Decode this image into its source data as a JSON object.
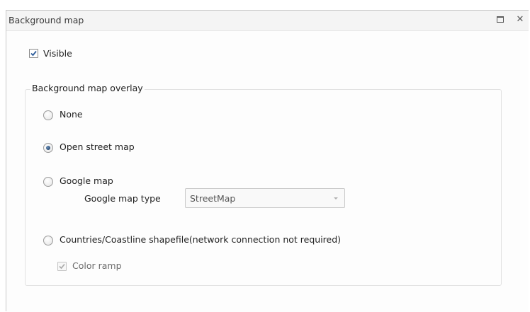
{
  "window": {
    "title": "Background map",
    "restore_icon": "restore-icon",
    "close_icon": "close-icon",
    "close_glyph": "✕"
  },
  "visible": {
    "label": "Visible",
    "checked": true
  },
  "overlay_group": {
    "title": "Background map overlay",
    "options": [
      {
        "label": "None",
        "selected": false
      },
      {
        "label": "Open street map",
        "selected": true
      },
      {
        "label": "Google map",
        "selected": false
      },
      {
        "label": "Countries/Coastline shapefile(network connection not required)",
        "selected": false
      }
    ],
    "google_map_type": {
      "label": "Google map type",
      "value": "StreetMap",
      "enabled": false
    },
    "color_ramp": {
      "label": "Color ramp",
      "checked": true,
      "enabled": false
    }
  },
  "colors": {
    "accent_radio": "#24466e",
    "check_mark": "#2b5b9a",
    "disabled_text": "#6b6b6b"
  }
}
